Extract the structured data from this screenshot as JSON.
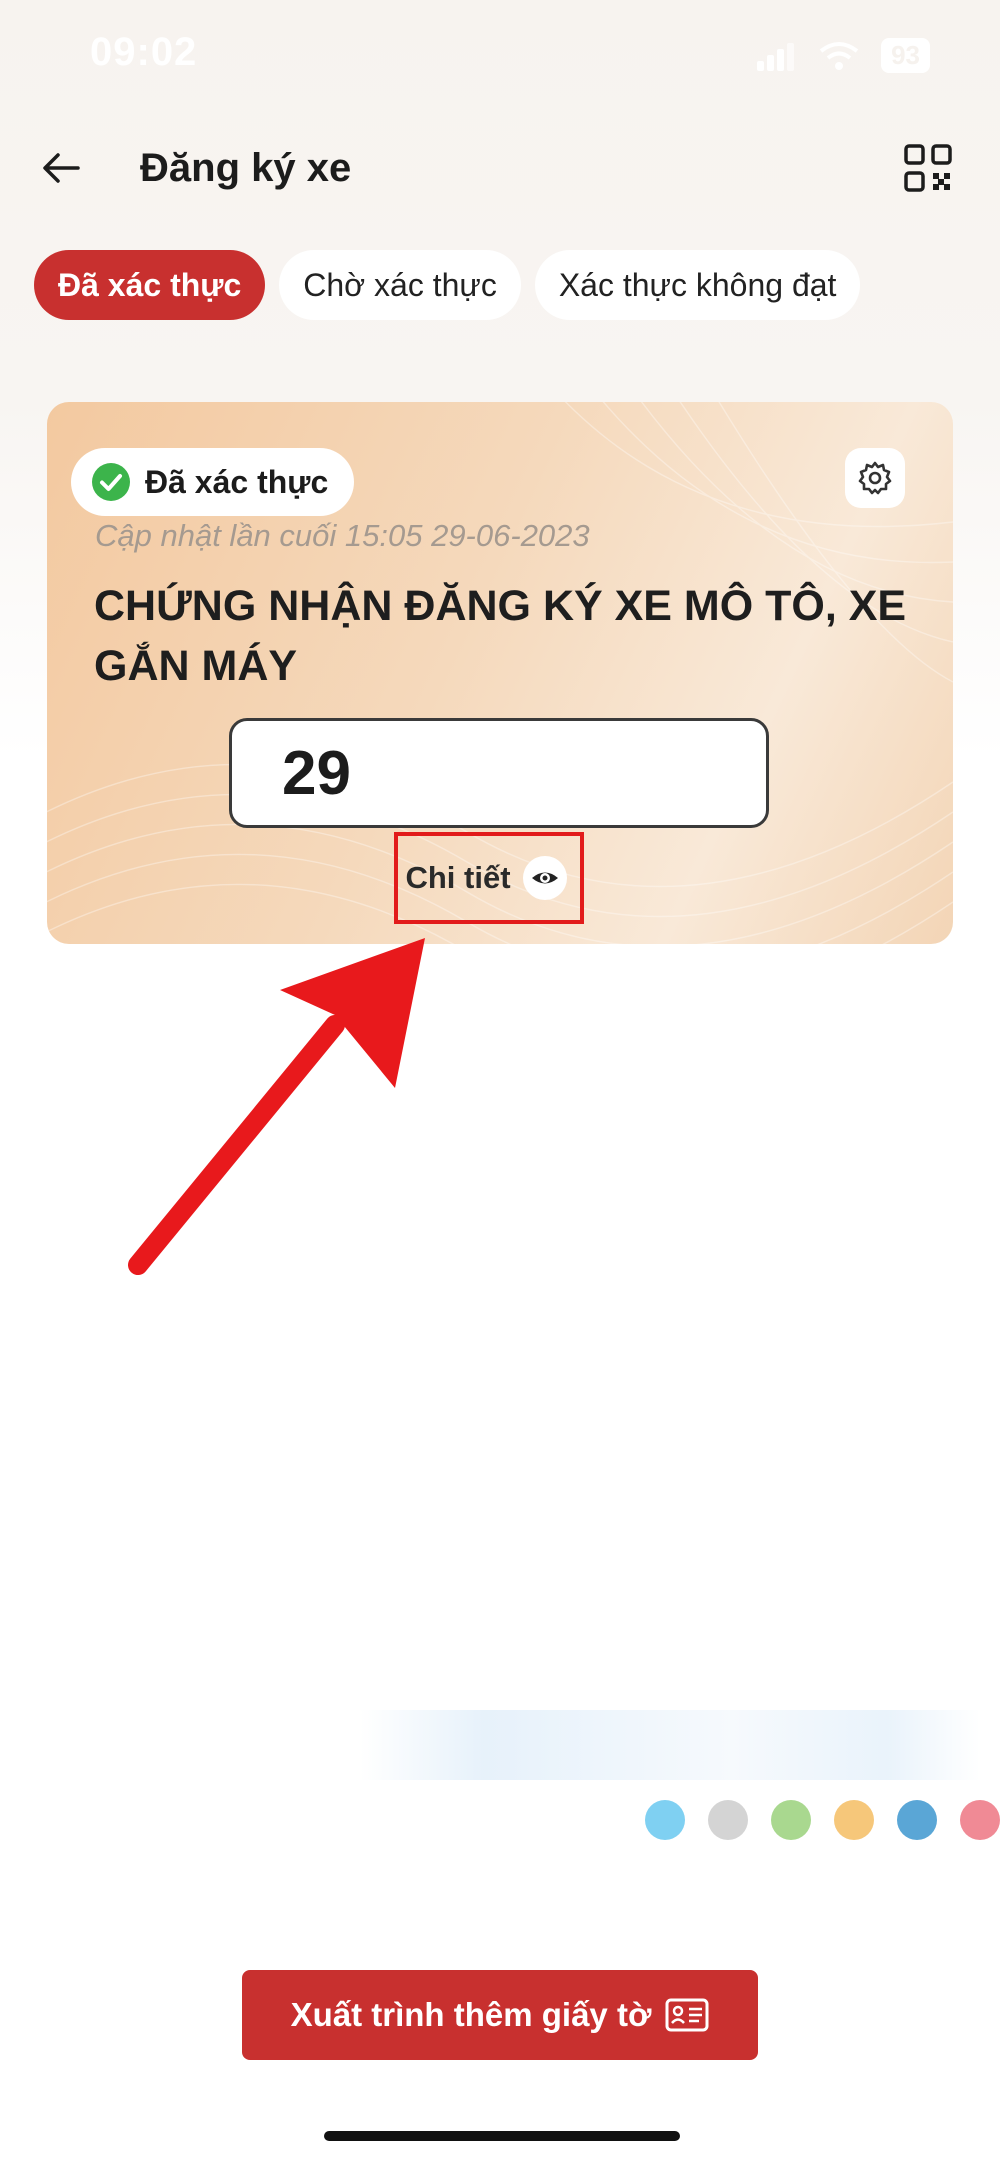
{
  "status_bar": {
    "time": "09:02",
    "battery": "93"
  },
  "header": {
    "title": "Đăng ký xe"
  },
  "tabs": [
    {
      "label": "Đã xác thực",
      "active": true
    },
    {
      "label": "Chờ xác thực",
      "active": false
    },
    {
      "label": "Xác thực không đạt",
      "active": false
    }
  ],
  "card": {
    "status_label": "Đã xác thực",
    "updated": "Cập nhật lần cuối 15:05 29-06-2023",
    "document_title": "CHỨNG NHẬN ĐĂNG KÝ XE MÔ TÔ, XE GẮN MÁY",
    "plate_number": "29",
    "detail_label": "Chi tiết"
  },
  "palette": {
    "accent": "#c8302f",
    "highlight": "#e21b1b",
    "verified_green": "#3cb44b",
    "dots": [
      "#7fd0f2",
      "#d4d4d4",
      "#a9d88f",
      "#f6c77a",
      "#5aa6d6",
      "#f08a95"
    ]
  },
  "footer": {
    "button_label": "Xuất trình thêm giấy tờ"
  }
}
